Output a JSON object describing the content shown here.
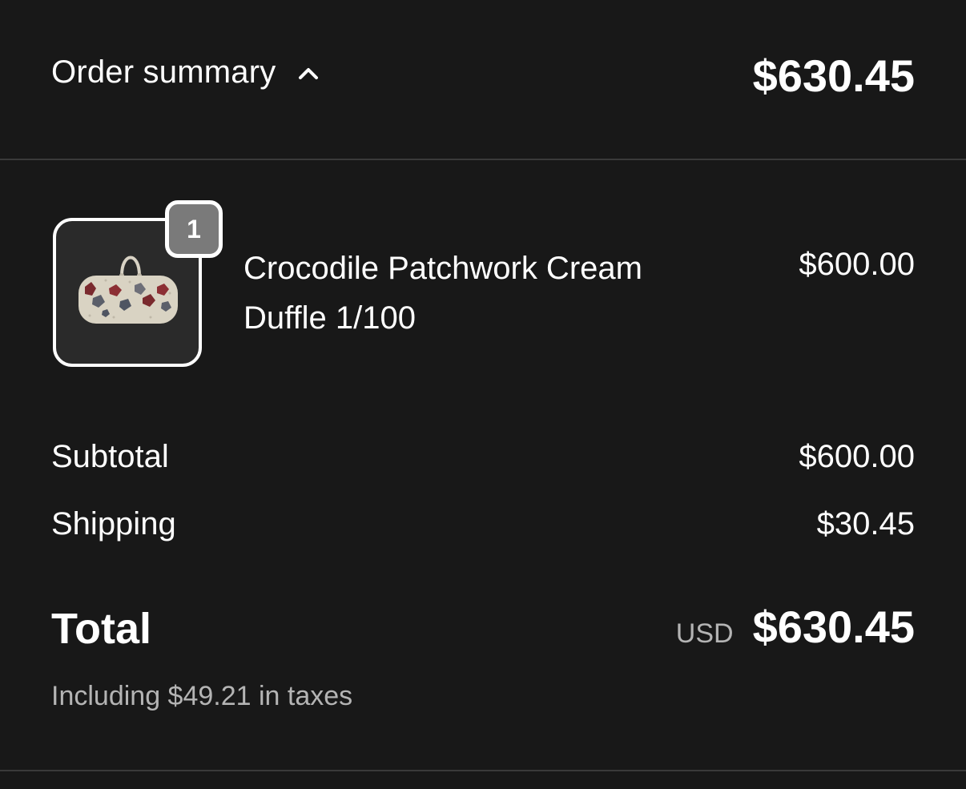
{
  "summary": {
    "toggle_label": "Order summary",
    "toggle_icon": "chevron-up-icon",
    "header_total": "$630.45"
  },
  "items": [
    {
      "name": "Crocodile Patchwork Cream Duffle 1/100",
      "price": "$600.00",
      "quantity": "1",
      "image_icon": "duffle-bag-thumbnail"
    }
  ],
  "totals": {
    "subtotal_label": "Subtotal",
    "subtotal_value": "$600.00",
    "shipping_label": "Shipping",
    "shipping_value": "$30.45",
    "total_label": "Total",
    "currency": "USD",
    "total_value": "$630.45",
    "taxes_note": "Including $49.21 in taxes"
  },
  "colors": {
    "background": "#181818",
    "divider": "#3a3a3a",
    "muted_text": "#b4b4b4",
    "badge": "#7a7a7a"
  }
}
